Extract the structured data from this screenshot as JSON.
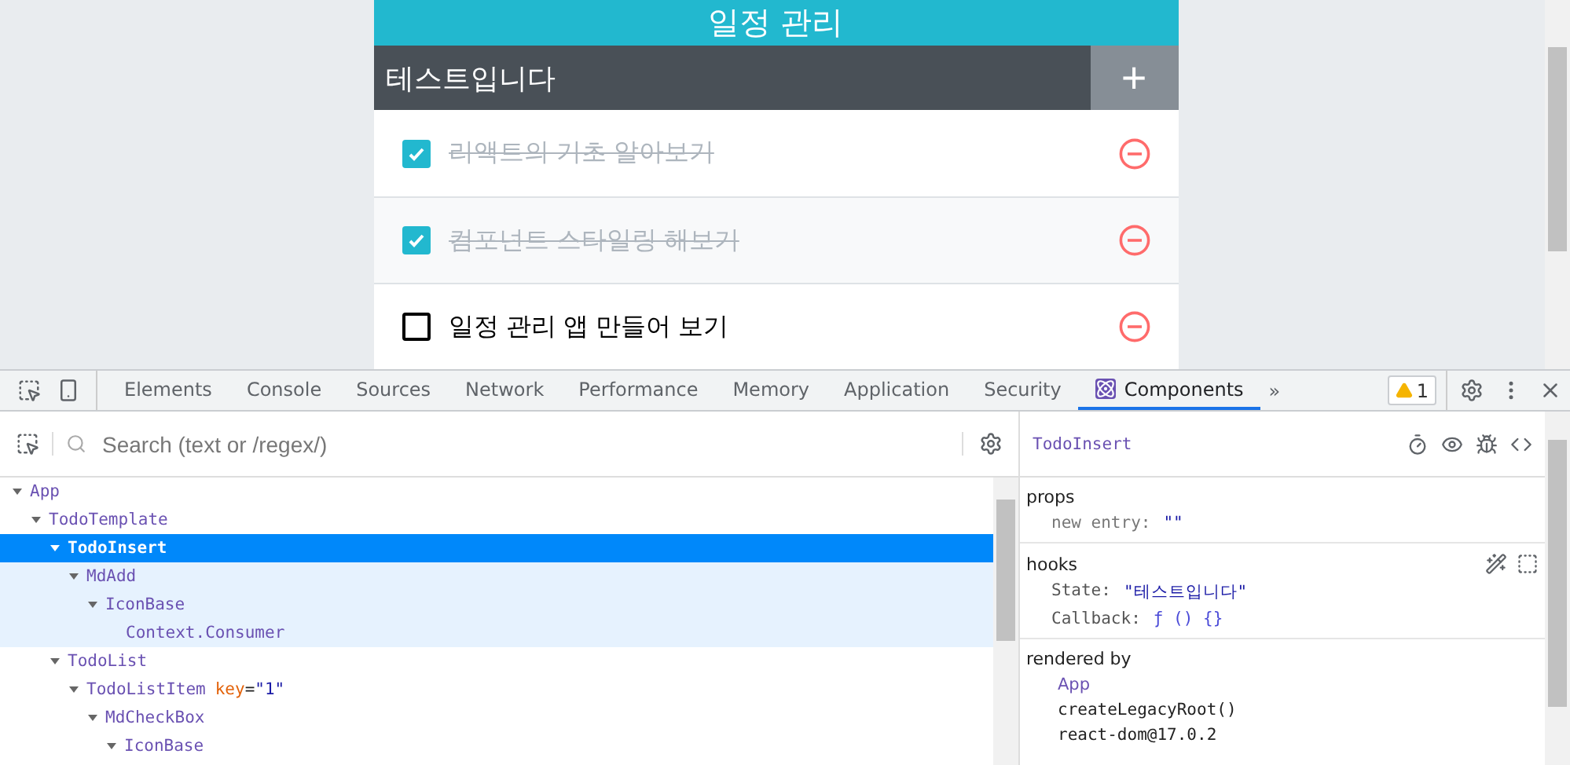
{
  "app": {
    "title": "일정 관리",
    "insert_value": "테스트입니다",
    "add_button": "+",
    "todos": [
      {
        "text": "리액트의 기초 알아보기",
        "checked": true
      },
      {
        "text": "컴포넌트 스타일링 해보기",
        "checked": true
      },
      {
        "text": "일정 관리 앱 만들어 보기",
        "checked": false
      }
    ]
  },
  "devtools": {
    "tabs": [
      {
        "label": "Elements",
        "selected": false
      },
      {
        "label": "Console",
        "selected": false
      },
      {
        "label": "Sources",
        "selected": false
      },
      {
        "label": "Network",
        "selected": false
      },
      {
        "label": "Performance",
        "selected": false
      },
      {
        "label": "Memory",
        "selected": false
      },
      {
        "label": "Application",
        "selected": false
      },
      {
        "label": "Security",
        "selected": false
      },
      {
        "label": "Components",
        "selected": true
      }
    ],
    "more_tabs": "»",
    "warning_count": "1",
    "search": {
      "placeholder": "Search (text or /regex/)"
    },
    "tree": [
      {
        "name": "App",
        "expanded": true,
        "selected": false,
        "children": [
          {
            "name": "TodoTemplate",
            "expanded": true,
            "selected": false,
            "children": [
              {
                "name": "TodoInsert",
                "expanded": true,
                "selected": true,
                "children": [
                  {
                    "name": "MdAdd",
                    "expanded": true,
                    "selected": false,
                    "children": [
                      {
                        "name": "IconBase",
                        "expanded": true,
                        "selected": false,
                        "children": [
                          {
                            "name": "Context.Consumer",
                            "selected": false
                          }
                        ]
                      }
                    ]
                  }
                ]
              },
              {
                "name": "TodoList",
                "expanded": true,
                "selected": false,
                "children": [
                  {
                    "name": "TodoListItem",
                    "key_label": "key",
                    "key_equals": "=",
                    "key_value": "\"1\"",
                    "expanded": true,
                    "selected": false,
                    "children": [
                      {
                        "name": "MdCheckBox",
                        "expanded": true,
                        "selected": false,
                        "children": [
                          {
                            "name": "IconBase",
                            "expanded": true,
                            "selected": false
                          }
                        ]
                      }
                    ]
                  }
                ]
              }
            ]
          }
        ]
      }
    ],
    "inspector": {
      "component": "TodoInsert",
      "props": {
        "title": "props",
        "items": [
          {
            "name": "new entry:",
            "value": "\"\""
          }
        ]
      },
      "hooks": {
        "title": "hooks",
        "items": [
          {
            "name": "State:",
            "value": "\"테스트입니다\"",
            "kind": "string"
          },
          {
            "name": "Callback:",
            "value": "ƒ () {}",
            "kind": "function"
          }
        ]
      },
      "rendered_by": {
        "title": "rendered by",
        "items": [
          {
            "text": "App",
            "kind": "component"
          },
          {
            "text": "createLegacyRoot()",
            "kind": "plain"
          },
          {
            "text": "react-dom@17.0.2",
            "kind": "plain"
          }
        ]
      }
    }
  }
}
